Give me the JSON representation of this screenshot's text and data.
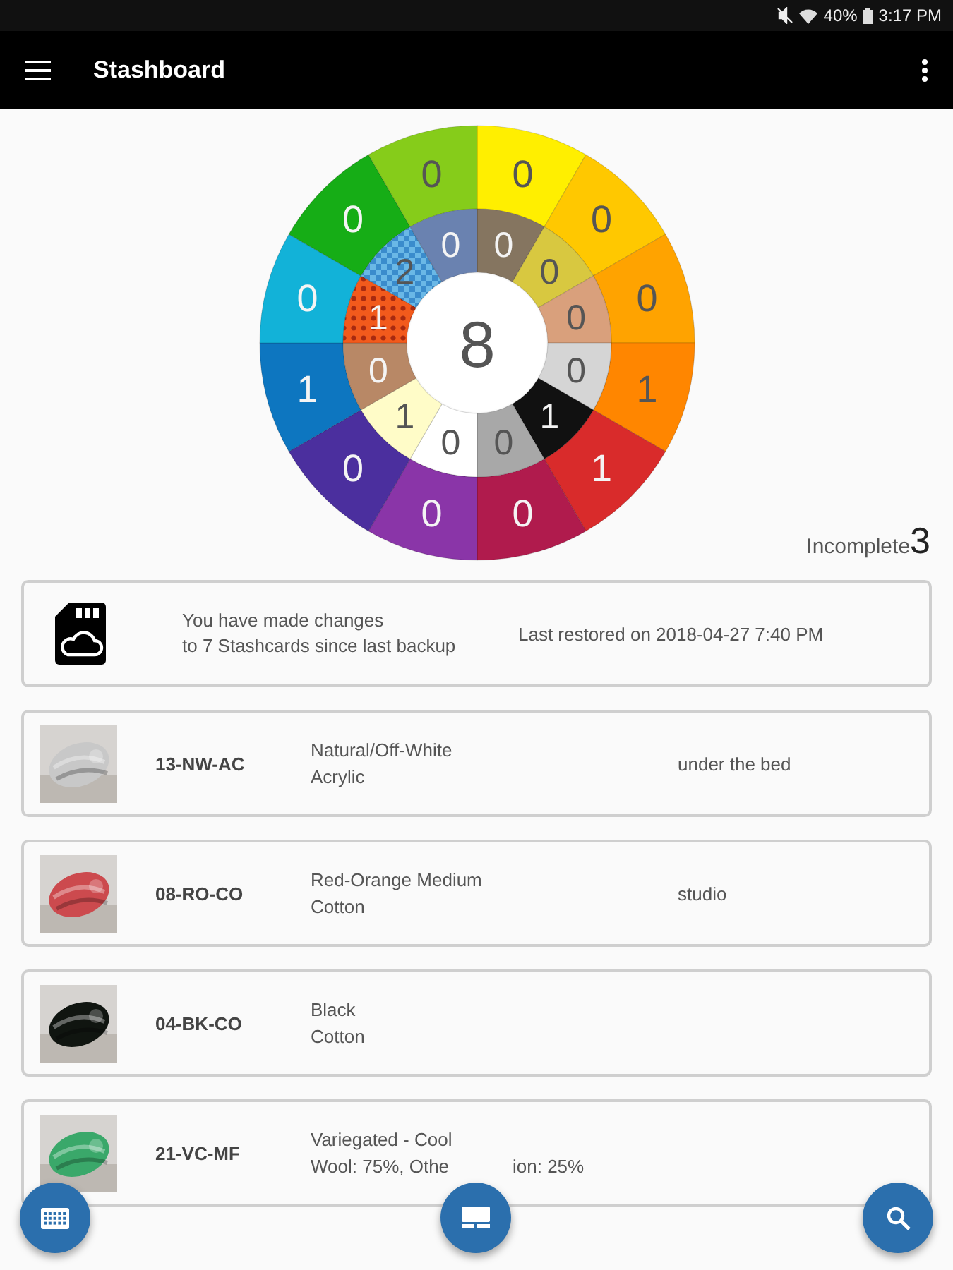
{
  "status_bar": {
    "battery": "40%",
    "time": "3:17 PM"
  },
  "app_bar": {
    "title": "Stashboard"
  },
  "wheel": {
    "total": "8",
    "outer": [
      {
        "count": "0",
        "color": "#ffef00"
      },
      {
        "count": "0",
        "color": "#ffc800"
      },
      {
        "count": "0",
        "color": "#ffa300"
      },
      {
        "count": "1",
        "color": "#ff8600"
      },
      {
        "count": "1",
        "color": "#d92b2b"
      },
      {
        "count": "0",
        "color": "#b01b4d"
      },
      {
        "count": "0",
        "color": "#8a35a8"
      },
      {
        "count": "0",
        "color": "#4b2f9e"
      },
      {
        "count": "1",
        "color": "#0d76c0"
      },
      {
        "count": "0",
        "color": "#12b2d8"
      },
      {
        "count": "0",
        "color": "#16ad16"
      },
      {
        "count": "0",
        "color": "#86cc1a"
      }
    ],
    "inner": [
      {
        "count": "0",
        "color": "#857560",
        "kind": "solid"
      },
      {
        "count": "0",
        "color": "#d8c840",
        "kind": "solid"
      },
      {
        "count": "0",
        "color": "#d9a07c",
        "kind": "solid"
      },
      {
        "count": "0",
        "color": "#d5d5d5",
        "kind": "solid"
      },
      {
        "count": "1",
        "color": "#111111",
        "kind": "solid"
      },
      {
        "count": "0",
        "color": "#a8a8a8",
        "kind": "solid"
      },
      {
        "count": "0",
        "color": "#ffffff",
        "kind": "solid"
      },
      {
        "count": "1",
        "color": "#fffcc8",
        "kind": "solid"
      },
      {
        "count": "0",
        "color": "#b88866",
        "kind": "solid"
      },
      {
        "count": "1",
        "color": "#f25a1c",
        "kind": "dots"
      },
      {
        "count": "2",
        "color": "#6ab8e6",
        "kind": "checks"
      },
      {
        "count": "0",
        "color": "#6a82b0",
        "kind": "solid"
      }
    ]
  },
  "incomplete": {
    "label": "Incomplete",
    "count": "3"
  },
  "backup_card": {
    "message_lines": [
      "You have made changes",
      "to 7 Stashcards since last backup"
    ],
    "restored": "Last restored on 2018-04-27 7:40 PM"
  },
  "stashcards": [
    {
      "code": "13-NW-AC",
      "name": "Natural/Off-White",
      "fiber": [
        "Acrylic"
      ],
      "location": "under the bed",
      "image": {
        "kind": "picture"
      }
    },
    {
      "code": "08-RO-CO",
      "name": "Red-Orange Medium",
      "fiber": [
        "Cotton"
      ],
      "location": "studio",
      "image": {
        "kind": "picture"
      }
    },
    {
      "code": "04-BK-CO",
      "name": "Black",
      "fiber": [
        "Cotton"
      ],
      "image": {
        "kind": "picture"
      }
    },
    {
      "code": "21-VC-MF",
      "name": "Variegated - Cool",
      "fiber": [
        "Wool: 75%, Othe",
        "ion: 25%"
      ],
      "image": {
        "kind": "picture"
      }
    }
  ]
}
